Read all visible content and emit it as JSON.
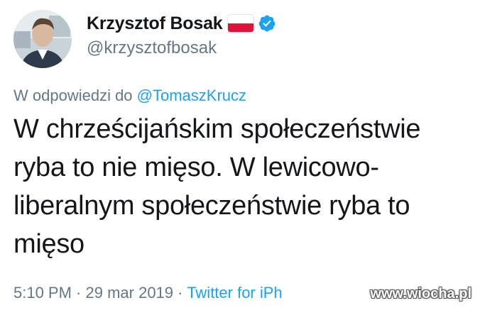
{
  "tweet": {
    "author": {
      "display_name": "Krzysztof Bosak",
      "handle": "@krzysztofbosak",
      "flag_icon": "poland-flag-icon",
      "verified_icon": "verified-badge-icon"
    },
    "reply": {
      "prefix": "W odpowiedzi do ",
      "mention": "@TomaszKrucz"
    },
    "text": "W chrześcijańskim społeczeństwie\nryba to nie mięso. W lewicowo-\nliberalnym społeczeństwie ryba to\nmięso",
    "meta": {
      "time": "5:10 PM",
      "separator1": " · ",
      "date": "29 mar 2019",
      "separator2": " · ",
      "source": "Twitter for iPh"
    }
  },
  "watermark": "www.wiocha.pl",
  "colors": {
    "text": "#14171a",
    "secondary": "#657786",
    "link": "#1da1f2",
    "verified": "#1da1f2",
    "flag_red": "#dc143c"
  }
}
